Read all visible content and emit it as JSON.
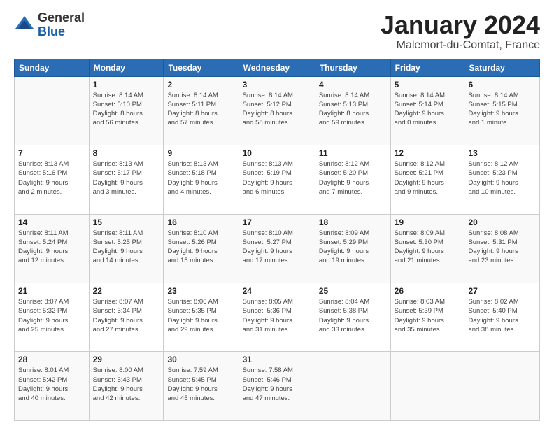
{
  "header": {
    "logo_general": "General",
    "logo_blue": "Blue",
    "month_title": "January 2024",
    "location": "Malemort-du-Comtat, France"
  },
  "weekdays": [
    "Sunday",
    "Monday",
    "Tuesday",
    "Wednesday",
    "Thursday",
    "Friday",
    "Saturday"
  ],
  "weeks": [
    [
      {
        "day": "",
        "info": ""
      },
      {
        "day": "1",
        "info": "Sunrise: 8:14 AM\nSunset: 5:10 PM\nDaylight: 8 hours\nand 56 minutes."
      },
      {
        "day": "2",
        "info": "Sunrise: 8:14 AM\nSunset: 5:11 PM\nDaylight: 8 hours\nand 57 minutes."
      },
      {
        "day": "3",
        "info": "Sunrise: 8:14 AM\nSunset: 5:12 PM\nDaylight: 8 hours\nand 58 minutes."
      },
      {
        "day": "4",
        "info": "Sunrise: 8:14 AM\nSunset: 5:13 PM\nDaylight: 8 hours\nand 59 minutes."
      },
      {
        "day": "5",
        "info": "Sunrise: 8:14 AM\nSunset: 5:14 PM\nDaylight: 9 hours\nand 0 minutes."
      },
      {
        "day": "6",
        "info": "Sunrise: 8:14 AM\nSunset: 5:15 PM\nDaylight: 9 hours\nand 1 minute."
      }
    ],
    [
      {
        "day": "7",
        "info": "Sunrise: 8:13 AM\nSunset: 5:16 PM\nDaylight: 9 hours\nand 2 minutes."
      },
      {
        "day": "8",
        "info": "Sunrise: 8:13 AM\nSunset: 5:17 PM\nDaylight: 9 hours\nand 3 minutes."
      },
      {
        "day": "9",
        "info": "Sunrise: 8:13 AM\nSunset: 5:18 PM\nDaylight: 9 hours\nand 4 minutes."
      },
      {
        "day": "10",
        "info": "Sunrise: 8:13 AM\nSunset: 5:19 PM\nDaylight: 9 hours\nand 6 minutes."
      },
      {
        "day": "11",
        "info": "Sunrise: 8:12 AM\nSunset: 5:20 PM\nDaylight: 9 hours\nand 7 minutes."
      },
      {
        "day": "12",
        "info": "Sunrise: 8:12 AM\nSunset: 5:21 PM\nDaylight: 9 hours\nand 9 minutes."
      },
      {
        "day": "13",
        "info": "Sunrise: 8:12 AM\nSunset: 5:23 PM\nDaylight: 9 hours\nand 10 minutes."
      }
    ],
    [
      {
        "day": "14",
        "info": "Sunrise: 8:11 AM\nSunset: 5:24 PM\nDaylight: 9 hours\nand 12 minutes."
      },
      {
        "day": "15",
        "info": "Sunrise: 8:11 AM\nSunset: 5:25 PM\nDaylight: 9 hours\nand 14 minutes."
      },
      {
        "day": "16",
        "info": "Sunrise: 8:10 AM\nSunset: 5:26 PM\nDaylight: 9 hours\nand 15 minutes."
      },
      {
        "day": "17",
        "info": "Sunrise: 8:10 AM\nSunset: 5:27 PM\nDaylight: 9 hours\nand 17 minutes."
      },
      {
        "day": "18",
        "info": "Sunrise: 8:09 AM\nSunset: 5:29 PM\nDaylight: 9 hours\nand 19 minutes."
      },
      {
        "day": "19",
        "info": "Sunrise: 8:09 AM\nSunset: 5:30 PM\nDaylight: 9 hours\nand 21 minutes."
      },
      {
        "day": "20",
        "info": "Sunrise: 8:08 AM\nSunset: 5:31 PM\nDaylight: 9 hours\nand 23 minutes."
      }
    ],
    [
      {
        "day": "21",
        "info": "Sunrise: 8:07 AM\nSunset: 5:32 PM\nDaylight: 9 hours\nand 25 minutes."
      },
      {
        "day": "22",
        "info": "Sunrise: 8:07 AM\nSunset: 5:34 PM\nDaylight: 9 hours\nand 27 minutes."
      },
      {
        "day": "23",
        "info": "Sunrise: 8:06 AM\nSunset: 5:35 PM\nDaylight: 9 hours\nand 29 minutes."
      },
      {
        "day": "24",
        "info": "Sunrise: 8:05 AM\nSunset: 5:36 PM\nDaylight: 9 hours\nand 31 minutes."
      },
      {
        "day": "25",
        "info": "Sunrise: 8:04 AM\nSunset: 5:38 PM\nDaylight: 9 hours\nand 33 minutes."
      },
      {
        "day": "26",
        "info": "Sunrise: 8:03 AM\nSunset: 5:39 PM\nDaylight: 9 hours\nand 35 minutes."
      },
      {
        "day": "27",
        "info": "Sunrise: 8:02 AM\nSunset: 5:40 PM\nDaylight: 9 hours\nand 38 minutes."
      }
    ],
    [
      {
        "day": "28",
        "info": "Sunrise: 8:01 AM\nSunset: 5:42 PM\nDaylight: 9 hours\nand 40 minutes."
      },
      {
        "day": "29",
        "info": "Sunrise: 8:00 AM\nSunset: 5:43 PM\nDaylight: 9 hours\nand 42 minutes."
      },
      {
        "day": "30",
        "info": "Sunrise: 7:59 AM\nSunset: 5:45 PM\nDaylight: 9 hours\nand 45 minutes."
      },
      {
        "day": "31",
        "info": "Sunrise: 7:58 AM\nSunset: 5:46 PM\nDaylight: 9 hours\nand 47 minutes."
      },
      {
        "day": "",
        "info": ""
      },
      {
        "day": "",
        "info": ""
      },
      {
        "day": "",
        "info": ""
      }
    ]
  ]
}
